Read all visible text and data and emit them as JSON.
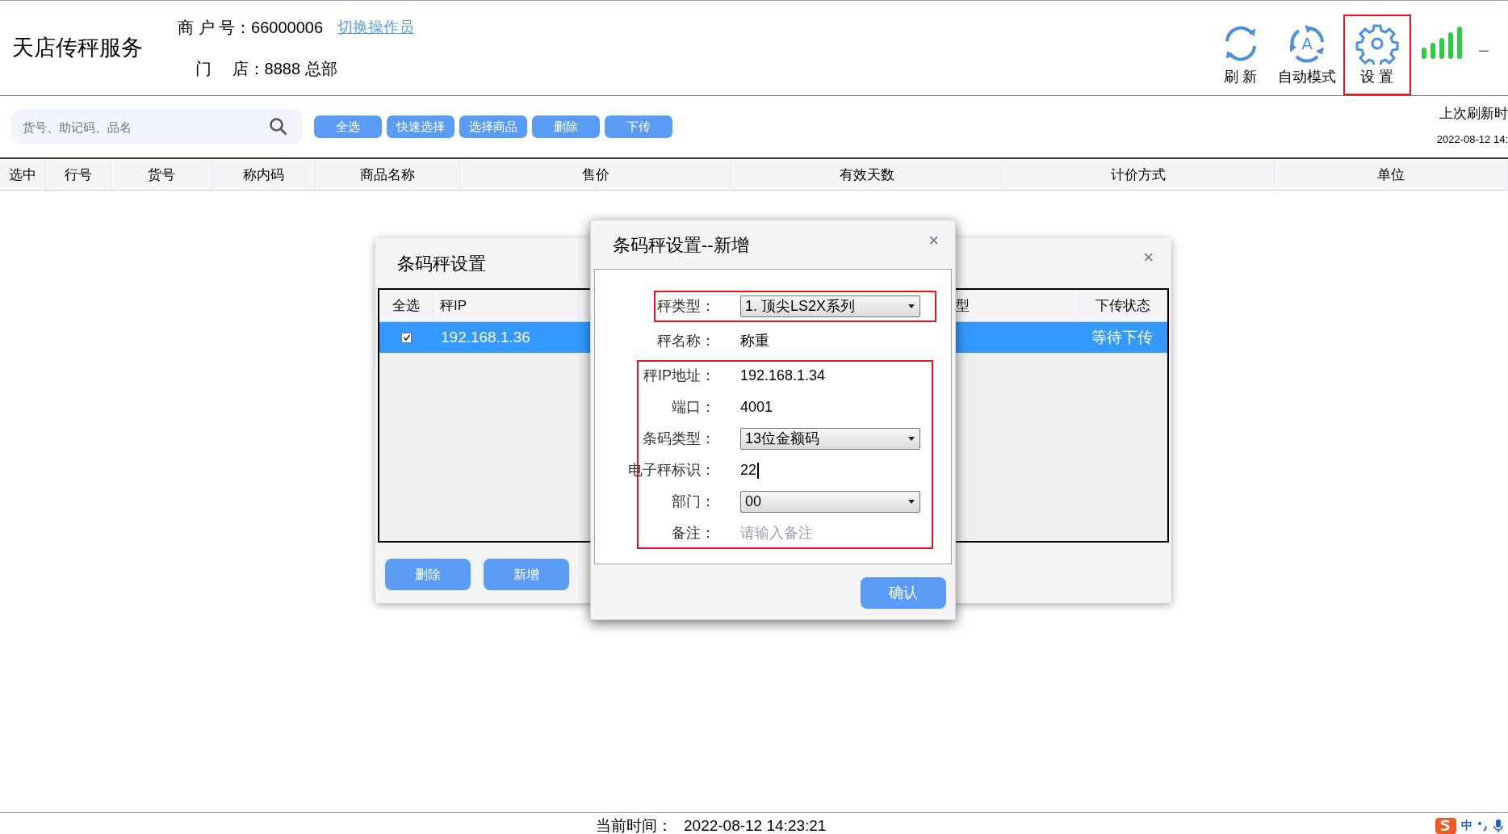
{
  "app": {
    "title": "天店传秤服务"
  },
  "header": {
    "merchant_label": "商 户 号：",
    "merchant_value": "66000006",
    "switch_link": "切换操作员",
    "store_label": "门　 店：",
    "store_value": "8888 总部",
    "actions": [
      {
        "kind": "refresh",
        "label": "刷 新",
        "highlighted": false
      },
      {
        "kind": "auto",
        "label": "自动模式",
        "icon_letter": "A",
        "highlighted": false
      },
      {
        "kind": "settings",
        "label": "设 置",
        "highlighted": true
      }
    ],
    "minimize": "–"
  },
  "toolbar": {
    "search": {
      "placeholder": "货号、助记码、品名"
    },
    "buttons": [
      "全选",
      "快速选择",
      "选择商品",
      "删除",
      "下传"
    ],
    "refresh_label": "上次刷新时",
    "refresh_time": "2022-08-12 14:"
  },
  "table": {
    "columns": [
      "选中",
      "行号",
      "货号",
      "称内码",
      "商品名称",
      "售价",
      "有效天数",
      "计价方式",
      "单位"
    ]
  },
  "scale_dialog": {
    "title": "条码秤设置",
    "close": "×",
    "columns": [
      "全选",
      "秤IP",
      "型",
      "下传状态"
    ],
    "rows": [
      {
        "checked": true,
        "selected": true,
        "ip": "192.168.1.36",
        "status": "等待下传"
      }
    ],
    "buttons": [
      "删除",
      "新增"
    ]
  },
  "add_dialog": {
    "title": "条码秤设置--新增",
    "close": "×",
    "sections": [
      {
        "highlighted": true,
        "fields": [
          {
            "kind": "select",
            "label": "秤类型：",
            "value": "1. 顶尖LS2X系列"
          }
        ]
      },
      {
        "highlighted": false,
        "fields": [
          {
            "kind": "text",
            "label": "秤名称：",
            "value": "称重"
          }
        ]
      },
      {
        "highlighted": true,
        "fields": [
          {
            "kind": "text",
            "label": "秤IP地址：",
            "value": "192.168.1.34"
          },
          {
            "kind": "text",
            "label": "端口：",
            "value": "4001"
          },
          {
            "kind": "select",
            "label": "条码类型：",
            "value": "13位金额码"
          },
          {
            "kind": "input",
            "label": "电子秤标识：",
            "value": "22",
            "focused": true
          },
          {
            "kind": "select",
            "label": "部门：",
            "value": "00"
          },
          {
            "kind": "input",
            "label": "备注：",
            "placeholder": "请输入备注",
            "focused": false
          }
        ]
      }
    ],
    "confirm": "确认"
  },
  "status_bar": {
    "label": "当前时间：",
    "time": "2022-08-12 14:23:21"
  },
  "ime": {
    "mode": "中"
  }
}
